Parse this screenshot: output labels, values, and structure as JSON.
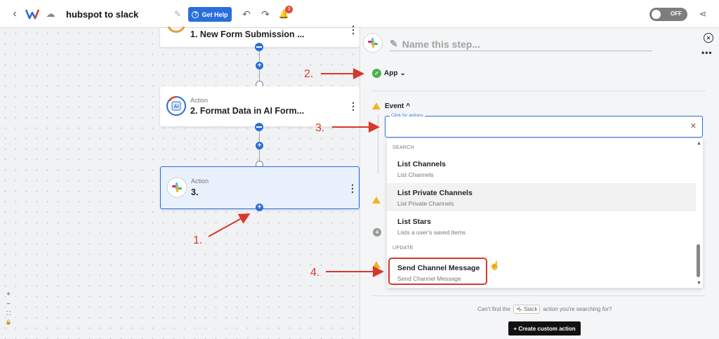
{
  "topbar": {
    "back_icon": "chevron-left-icon",
    "workflow_name": "hubspot to slack",
    "help_label": "Get Help",
    "notification_count": "3",
    "toggle_label": "OFF"
  },
  "canvas": {
    "nodes": [
      {
        "kind": "",
        "title": "1. New Form Submission ..."
      },
      {
        "kind": "Action",
        "title": "2. Format Data in AI Form..."
      },
      {
        "kind": "Action",
        "title": "3."
      }
    ],
    "zoom_controls": [
      "+",
      "−",
      "⛶",
      "🔒"
    ]
  },
  "panel": {
    "step_name_placeholder": "Name this step...",
    "app_label": "App",
    "event_label": "Event",
    "event_input_label": "Click for actions",
    "dropdown": {
      "groups": {
        "search": "SEARCH",
        "update": "UPDATE"
      },
      "items": [
        {
          "title": "List Channels",
          "desc": "List Channels"
        },
        {
          "title": "List Private Channels",
          "desc": "List Private Channels"
        },
        {
          "title": "List Stars",
          "desc": "Lists a user's saved items"
        },
        {
          "title": "Send Channel Message",
          "desc": "Send Channel Message"
        }
      ]
    },
    "section_number": "4",
    "cant_find_pre": "Can't find the",
    "cant_find_app": "Slack",
    "cant_find_post": "action you're searching for?",
    "create_custom_action": "+ Create custom action"
  },
  "annotations": [
    "1.",
    "2.",
    "3.",
    "4."
  ],
  "colors": {
    "accent": "#2a6edb",
    "annotation": "#d8382a",
    "success": "#4caf50",
    "warning": "#f0b429"
  }
}
